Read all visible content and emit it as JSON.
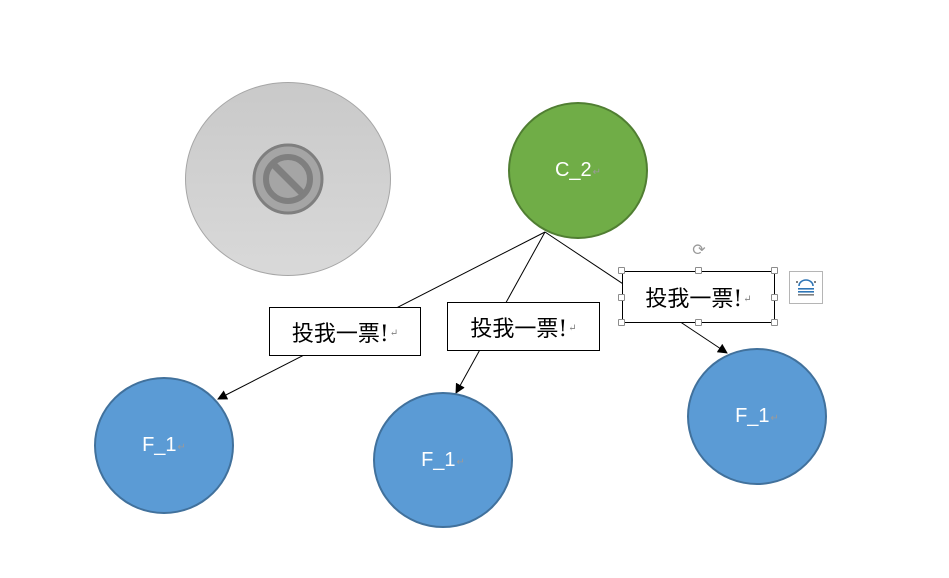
{
  "diagram": {
    "root": {
      "label": "C_2"
    },
    "children": [
      {
        "label": "F_1"
      },
      {
        "label": "F_1"
      },
      {
        "label": "F_1"
      }
    ],
    "edge_labels": [
      "投我一票!",
      "投我一票!",
      "投我一票!"
    ],
    "disabled_node": {
      "icon": "prohibited-icon"
    },
    "text_box_layout_options": {
      "icon": "text-wrap-icon"
    },
    "rotate_handle": {
      "icon": "rotate-icon"
    }
  },
  "colors": {
    "root_fill": "#70ad47",
    "child_fill": "#5b9bd5",
    "disabled_fill": "#d0d0d0"
  }
}
